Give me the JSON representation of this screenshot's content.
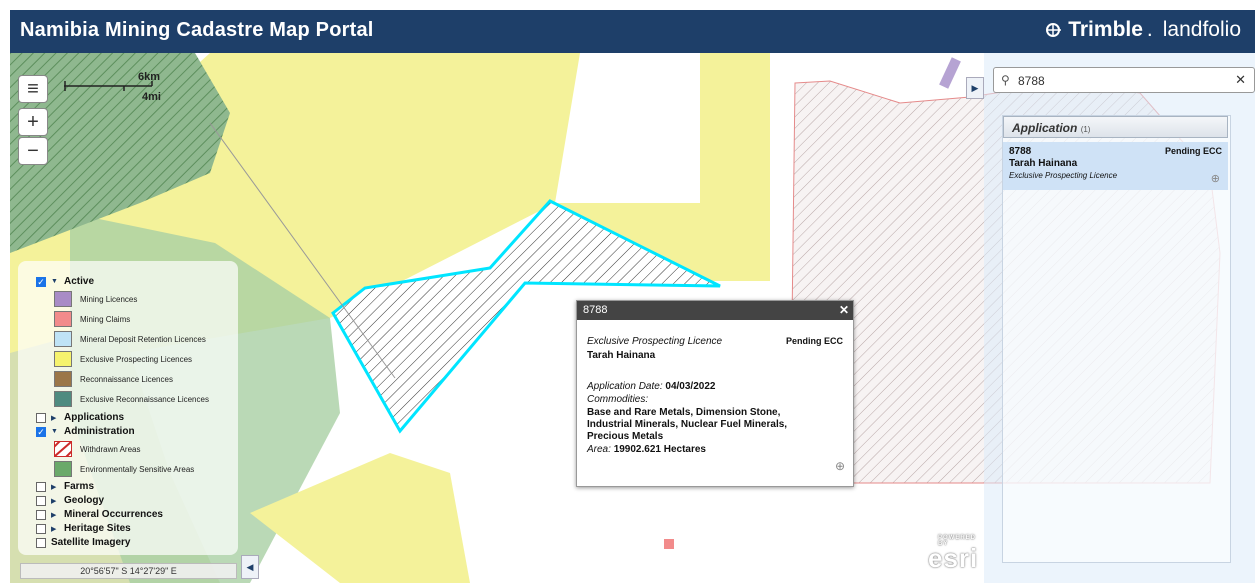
{
  "header": {
    "title": "Namibia Mining Cadastre Map Portal",
    "brand_name": "Trimble",
    "brand_product": "landfolio"
  },
  "map": {
    "scale_km": "6km",
    "scale_mi": "4mi",
    "coordinates": "20°56'57\" S  14°27'29\" E",
    "attribution": "esri",
    "attribution_small": "POWERED BY"
  },
  "icons": {
    "menu": "menu-icon",
    "zoom_in": "plus-icon",
    "zoom_out": "minus-icon",
    "search": "search-icon",
    "clear": "close-icon"
  },
  "legend": {
    "active_label": "Active",
    "active_items": [
      {
        "label": "Mining Licences",
        "color": "#a98cc6"
      },
      {
        "label": "Mining Claims",
        "color": "#f28b8b"
      },
      {
        "label": "Mineral Deposit Retention Licences",
        "color": "#bfe3f6"
      },
      {
        "label": "Exclusive Prospecting Licences",
        "color": "#f6f36e"
      },
      {
        "label": "Reconnaissance Licences",
        "color": "#9b7648"
      },
      {
        "label": "Exclusive Reconnaissance Licences",
        "color": "#4f8b80"
      }
    ],
    "applications_label": "Applications",
    "administration_label": "Administration",
    "admin_items": [
      {
        "label": "Withdrawn Areas",
        "color": "#cc2a2a"
      },
      {
        "label": "Environmentally Sensitive Areas",
        "color": "#6aa96a"
      }
    ],
    "farms_label": "Farms",
    "geology_label": "Geology",
    "mineral_label": "Mineral Occurrences",
    "heritage_label": "Heritage Sites",
    "satellite_label": "Satellite Imagery"
  },
  "popup": {
    "title": "8788",
    "close": "✕",
    "licence_type": "Exclusive Prospecting Licence",
    "status": "Pending ECC",
    "holder": "Tarah Hainana",
    "app_date_label": "Application Date:",
    "app_date": "04/03/2022",
    "commodities_label": "Commodities:",
    "commodities_1": "Base and Rare Metals, Dimension Stone,",
    "commodities_2": "Industrial Minerals, Nuclear Fuel Minerals,",
    "commodities_3": "Precious Metals",
    "area_label": "Area:",
    "area": "19902.621 Hectares"
  },
  "search": {
    "value": "8788"
  },
  "results": {
    "header": "Application",
    "count": "(1)",
    "items": [
      {
        "number": "8788",
        "status": "Pending ECC",
        "holder": "Tarah Hainana",
        "type": "Exclusive Prospecting Licence"
      }
    ]
  }
}
